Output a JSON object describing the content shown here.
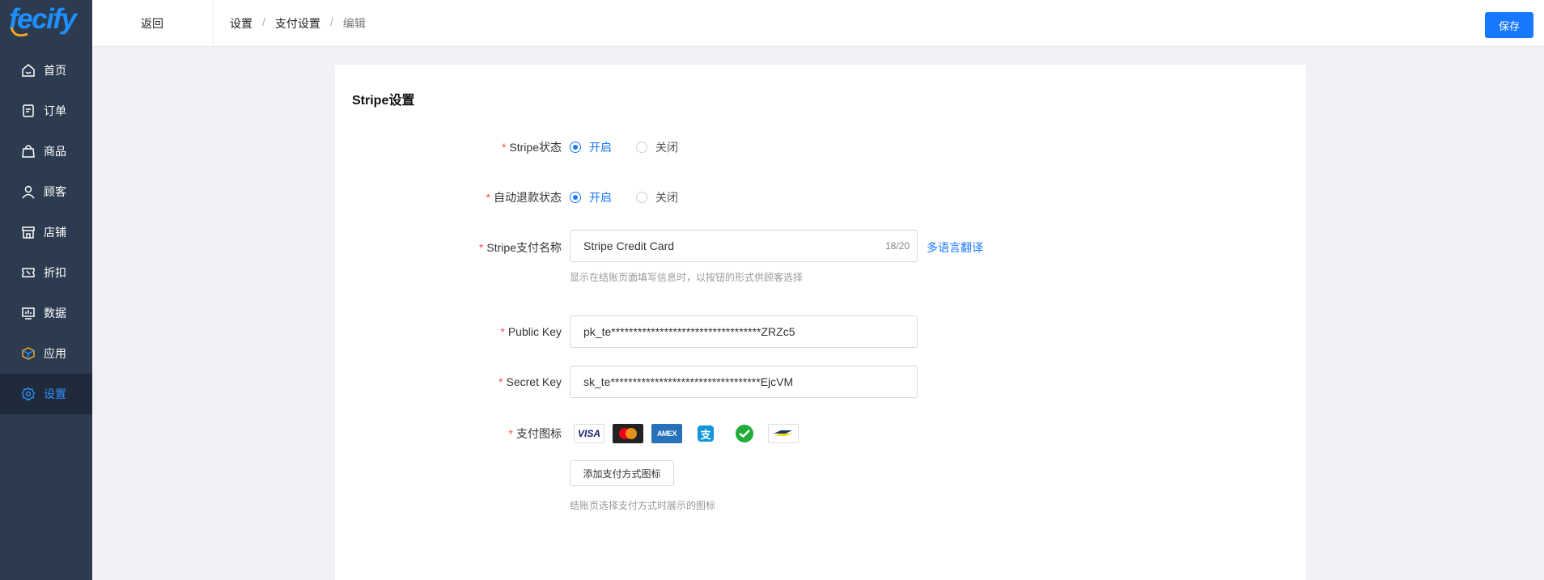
{
  "brand": {
    "logo_text": "fecify"
  },
  "sidebar": {
    "items": [
      {
        "label": "首页",
        "icon": "home-icon"
      },
      {
        "label": "订单",
        "icon": "order-icon"
      },
      {
        "label": "商品",
        "icon": "bag-icon"
      },
      {
        "label": "顾客",
        "icon": "user-icon"
      },
      {
        "label": "店铺",
        "icon": "store-icon"
      },
      {
        "label": "折扣",
        "icon": "ticket-icon"
      },
      {
        "label": "数据",
        "icon": "chart-icon"
      },
      {
        "label": "应用",
        "icon": "cube-icon"
      },
      {
        "label": "设置",
        "icon": "gear-icon",
        "active": true
      }
    ]
  },
  "topbar": {
    "back_label": "返回",
    "breadcrumb": [
      "设置",
      "支付设置",
      "编辑"
    ],
    "save_label": "保存"
  },
  "card": {
    "title": "Stripe设置",
    "status": {
      "label": "Stripe状态",
      "on": "开启",
      "off": "关闭",
      "value": "开启"
    },
    "auto_refund": {
      "label": "自动退款状态",
      "on": "开启",
      "off": "关闭",
      "value": "开启"
    },
    "pay_name": {
      "label": "Stripe支付名称",
      "value": "Stripe Credit Card",
      "count": "18/20",
      "translate_link": "多语言翻译",
      "hint": "显示在结账页面填写信息时，以按钮的形式供顾客选择"
    },
    "public_key": {
      "label": "Public Key",
      "value": "pk_te**********************************ZRZc5"
    },
    "secret_key": {
      "label": "Secret Key",
      "value": "sk_te**********************************EjcVM"
    },
    "pay_icons": {
      "label": "支付图标",
      "icons": [
        "visa-icon",
        "mastercard-icon",
        "amex-icon",
        "alipay-icon",
        "wechat-pay-icon",
        "bancontact-icon"
      ],
      "visa_text": "VISA",
      "amex_text": "AMEX",
      "alipay_text": "支",
      "add_button": "添加支付方式图标",
      "hint": "结账页选择支付方式时展示的图标"
    }
  },
  "colors": {
    "accent": "#1677ff",
    "sidebar_bg": "#2c3b4f",
    "sidebar_active_bg": "#1f2b3a",
    "required": "#ff4d4f"
  }
}
